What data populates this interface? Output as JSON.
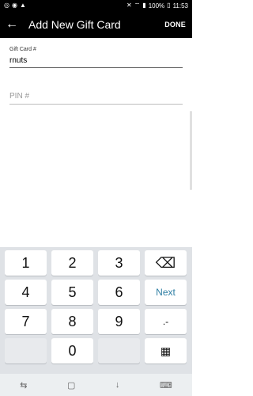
{
  "status_bar": {
    "left_icons": [
      "whatsapp-icon",
      "alert-icon",
      "warning-icon"
    ],
    "battery": "100%",
    "time": "11:53"
  },
  "app_bar": {
    "title": "Add New Gift Card",
    "done": "DONE",
    "back_icon": "back-arrow-icon"
  },
  "form": {
    "gift_card_label": "Gift Card #",
    "gift_card_value": "rnuts",
    "pin_placeholder": "PIN #"
  },
  "keyboard": {
    "row1": [
      "1",
      "2",
      "3"
    ],
    "row2": [
      "4",
      "5",
      "6"
    ],
    "next": "Next",
    "row3": [
      "7",
      "8",
      "9"
    ],
    "dot_dash": ".-",
    "zero": "0"
  },
  "nav_bar": {
    "icons": [
      "recent-apps-icon",
      "home-icon",
      "back-icon",
      "keyboard-hide-icon"
    ]
  }
}
